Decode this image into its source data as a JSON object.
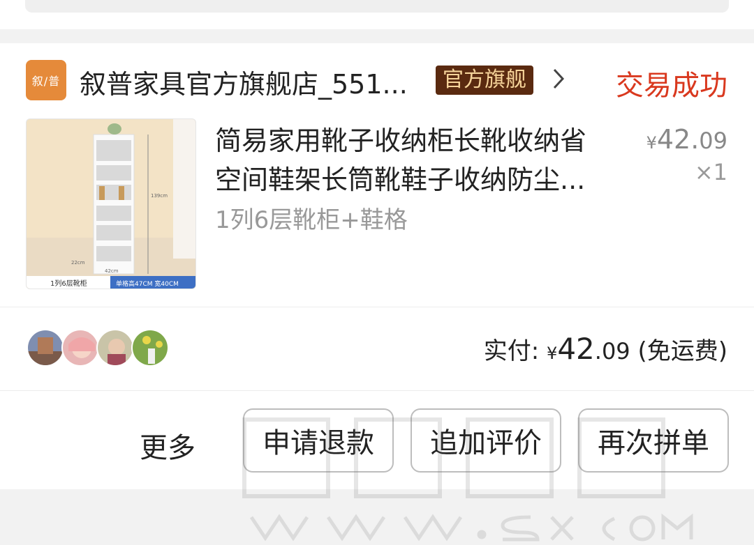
{
  "shop": {
    "logo_text": "叙/普",
    "name": "叙普家具官方旗舰店_551...",
    "badge": "官方旗舰",
    "status": "交易成功"
  },
  "product": {
    "title_line1": "简易家用靴子收纳柜长靴收纳省",
    "title_line2": "空间鞋架长筒靴鞋子收纳防尘...",
    "spec": "1列6层靴柜+鞋格",
    "price_symbol": "¥",
    "price_int": "42.",
    "price_dec": "09",
    "quantity": "×1",
    "image_caption_left": "1列6层靴柜",
    "image_caption_right": "单格高47CM 宽40CM",
    "image_dim_height": "139cm",
    "image_dim_depth": "22cm",
    "image_dim_width": "42cm"
  },
  "payment": {
    "label": "实付: ",
    "symbol": "¥",
    "amount_int": "42",
    "amount_dec": ".09",
    "note": " (免运费)"
  },
  "actions": {
    "more": "更多",
    "refund": "申请退款",
    "review": "追加评价",
    "reorder": "再次拼单"
  },
  "colors": {
    "status": "#d9381e",
    "badge_bg": "#5a2a10",
    "badge_text": "#f6d49a",
    "logo_bg": "#e58a3a"
  }
}
